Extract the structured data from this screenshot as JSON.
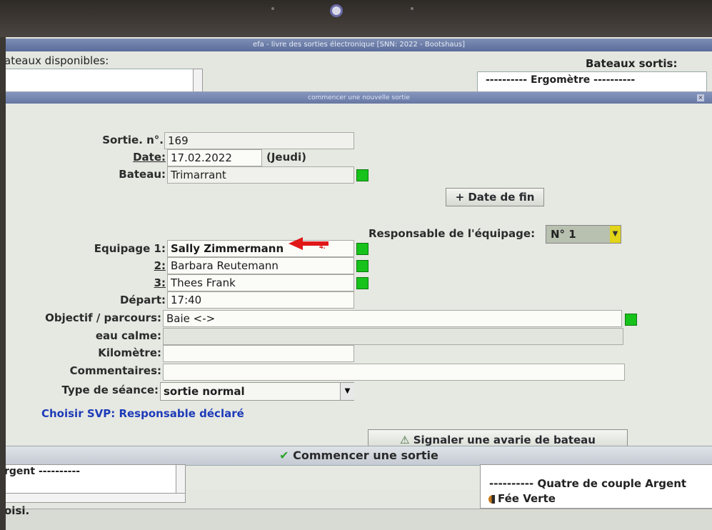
{
  "window_title": "efa - livre des sorties électronique [SNN: 2022 - Bootshaus]",
  "dialog_title": "commencer une nouvelle sortie",
  "left_panel": {
    "title": "ateaux disponibles:",
    "bottom_item": "rgent ----------",
    "status": "oisi."
  },
  "right_panel": {
    "title": "Bateaux sortis:",
    "top_group": "---------- Ergomètre ----------",
    "bottom_group": "---------- Quatre de couple Argent",
    "bottom_boat": "Fée Verte"
  },
  "form": {
    "sortie_label": "Sortie. n°.:",
    "sortie_value": "169",
    "date_label": "Date:",
    "date_value": "17.02.2022",
    "weekday": "(Jeudi)",
    "date_fin_button": "+ Date de fin",
    "bateau_label": "Bateau:",
    "bateau_value": "Trimarrant",
    "responsable_label": "Responsable de l'équipage:",
    "responsable_value": "N° 1",
    "equipage1_label": "Equipage 1:",
    "equipage1_value": "Sally Zimmermann",
    "equipage2_label": "2:",
    "equipage2_value": "Barbara Reutemann",
    "equipage3_label": "3:",
    "equipage3_value": "Thees Frank",
    "depart_label": "Départ:",
    "depart_value": "17:40",
    "objectif_label": "Objectif / parcours:",
    "objectif_value": "Baie <->",
    "eau_calme_label": "eau calme:",
    "kilometre_label": "Kilomètre:",
    "commentaires_label": "Commentaires:",
    "type_label": "Type de séance:",
    "type_value": "sortie normal",
    "choisir_text": "Choisir SVP: Responsable déclaré",
    "avarie_button": "Signaler une avarie de bateau",
    "commencer_button": "Commencer une sortie"
  },
  "annotation": {
    "arrow_number": "4."
  },
  "colors": {
    "ok_indicator": "#17c21b",
    "link_text": "#1d3bb8",
    "annotation_arrow": "#e01818"
  }
}
